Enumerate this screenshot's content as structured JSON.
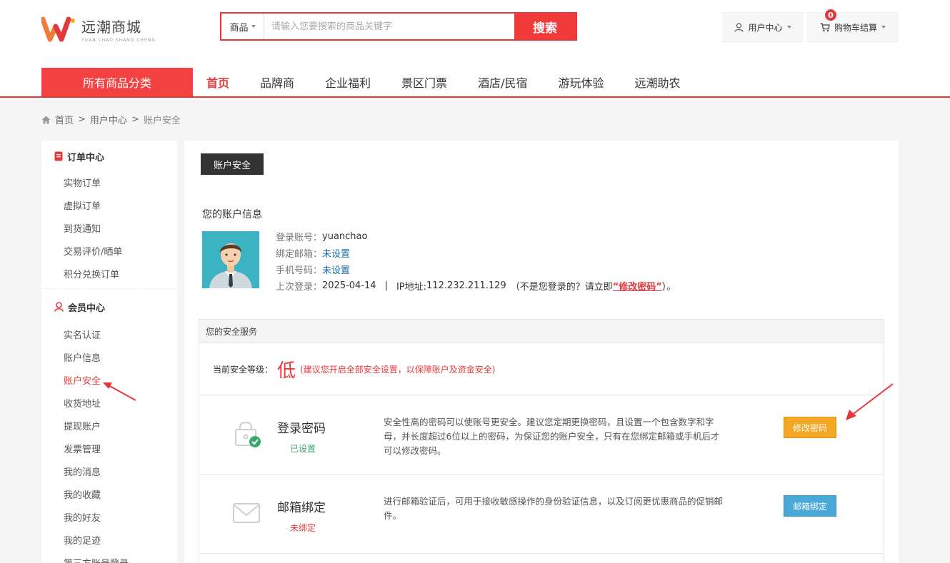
{
  "brand": {
    "name": "远潮商城",
    "subtitle": "YUAN CHAO SHANG CHENG"
  },
  "search": {
    "category": "商品",
    "placeholder": "请输入您要搜索的商品关键字",
    "button": "搜索"
  },
  "header": {
    "user_center": "用户中心",
    "cart": "购物车结算",
    "cart_count": "0"
  },
  "nav": {
    "all_categories": "所有商品分类",
    "items": [
      "首页",
      "品牌商",
      "企业福利",
      "景区门票",
      "酒店/民宿",
      "游玩体验",
      "远潮助农"
    ]
  },
  "breadcrumb": {
    "home": "首页",
    "sep1": ">",
    "level2": "用户中心",
    "sep2": ">",
    "current": "账户安全"
  },
  "sidebar": {
    "order_title": "订单中心",
    "orders": [
      "实物订单",
      "虚拟订单",
      "到货通知",
      "交易评价/晒单",
      "积分兑换订单"
    ],
    "member_title": "会员中心",
    "members": [
      "实名认证",
      "账户信息",
      "账户安全",
      "收货地址",
      "提现账户",
      "发票管理",
      "我的消息",
      "我的收藏",
      "我的好友",
      "我的足迹",
      "第三方账号登录"
    ]
  },
  "main": {
    "tab": "账户安全",
    "account_title": "您的账户信息",
    "login_label": "登录账号：",
    "login_value": "yuanchao",
    "email_label": "绑定邮箱：",
    "email_value": "未设置",
    "phone_label": "手机号码：",
    "phone_value": "未设置",
    "last_login_label": "上次登录：",
    "last_login_date": "2025-04-14",
    "divider": "|",
    "ip_label": "IP地址:",
    "ip_value": "112.232.211.129",
    "not_you": "（不是您登录的？请立即",
    "change_pwd_link": "“修改密码”",
    "not_you_end": "）。"
  },
  "security": {
    "head": "您的安全服务",
    "level_label": "当前安全等级：",
    "level": "低",
    "level_tip": "(建议您开启全部安全设置，以保障账户及资金安全)",
    "password": {
      "name": "登录密码",
      "status": "已设置",
      "desc": "安全性高的密码可以使账号更安全。建议您定期更换密码，且设置一个包含数字和字母，并长度超过6位以上的密码，为保证您的账户安全，只有在您绑定邮箱或手机后才可以修改密码。",
      "button": "修改密码"
    },
    "email": {
      "name": "邮箱绑定",
      "status": "未绑定",
      "desc": "进行邮箱验证后，可用于接收敏感操作的身份验证信息，以及订阅更优惠商品的促销邮件。",
      "button": "邮箱绑定"
    }
  },
  "colors": {
    "accent": "#e4393c",
    "nav_all": "#f44242",
    "orange": "#f5a623",
    "blue": "#4aa8d8",
    "green": "#3aa76d"
  }
}
